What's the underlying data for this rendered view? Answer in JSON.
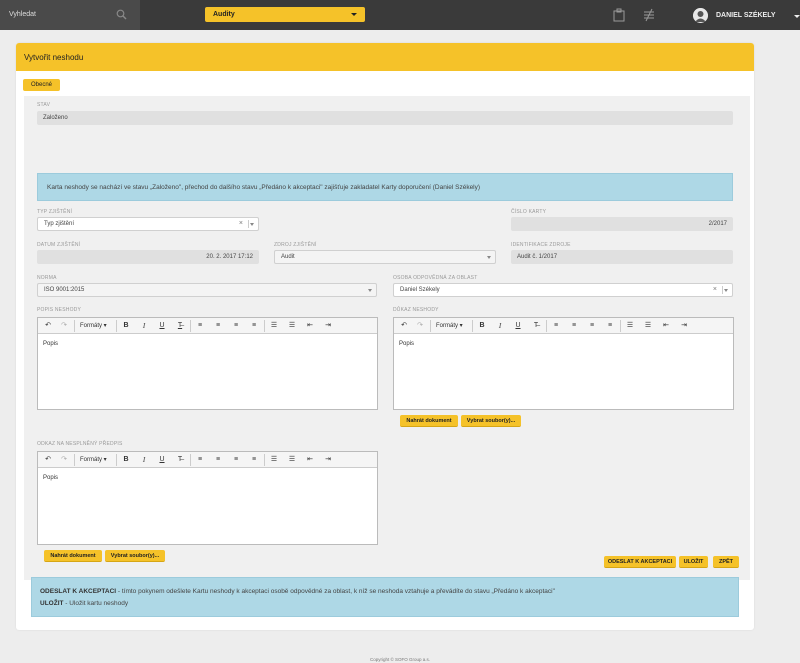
{
  "topbar": {
    "search_label": "Vyhledat",
    "module_label": "Audity",
    "user_name": "DANIEL SZÉKELY"
  },
  "form": {
    "title": "Vytvořit neshodu",
    "tab_general": "Obecné",
    "stav_label": "STAV",
    "stav_value": "Založeno",
    "info_text": "Karta neshody se nachází ve stavu „Založeno\", přechod do dalšího stavu „Předáno k akceptaci\" zajišťuje zakladatel Karty doporučení (Daniel Székely)",
    "typ_label": "TYP ZJIŠTĚNÍ",
    "typ_value": "Typ zjištění",
    "cislo_label": "ČÍSLO KARTY",
    "cislo_value": "2/2017",
    "datum_label": "DATUM ZJIŠTĚNÍ",
    "datum_value": "20. 2. 2017 17:12",
    "zdroj_label": "ZDROJ ZJIŠTĚNÍ",
    "zdroj_value": "Audit",
    "ident_label": "IDENTIFIKACE ZDROJE",
    "ident_value": "Audit č. 1/2017",
    "norma_label": "NORMA",
    "norma_value": "ISO 9001:2015",
    "osoba_label": "OSOBA ODPOVĚDNÁ ZA OBLAST",
    "osoba_value": "Daniel Székely",
    "popis_label": "POPIS NESHODY",
    "dukaz_label": "DŮKAZ NESHODY",
    "predpis_label": "ODKAZ NA NESPLNĚNÝ PŘEDPIS",
    "editor_formats": "Formáty",
    "editor_placeholder_1": "Popis",
    "editor_placeholder_2": "Popis",
    "editor_placeholder_3": "Popis",
    "upload_btn": "Nahrát dokument",
    "choose_btn": "Vybrat soubor(y)..."
  },
  "actions": {
    "send": "ODESLAT K AKCEPTACI",
    "save": "ULOŽIT",
    "back": "ZPĚT"
  },
  "help": {
    "send_title": "ODESLAT K AKCEPTACI",
    "send_text": " - tímto pokynem odešlete Kartu neshody k akceptaci osobě odpovědné za oblast, k níž se neshoda vztahuje a převádíte do stavu „Předáno k akceptaci\"",
    "save_title": "ULOŽIT",
    "save_text": " - Uložit kartu neshody"
  },
  "footer": "Copyright © SOFO Group a.s.",
  "colors": {
    "accent": "#f5c229",
    "topbar": "#3a3a3a",
    "info": "#aed8e6"
  }
}
